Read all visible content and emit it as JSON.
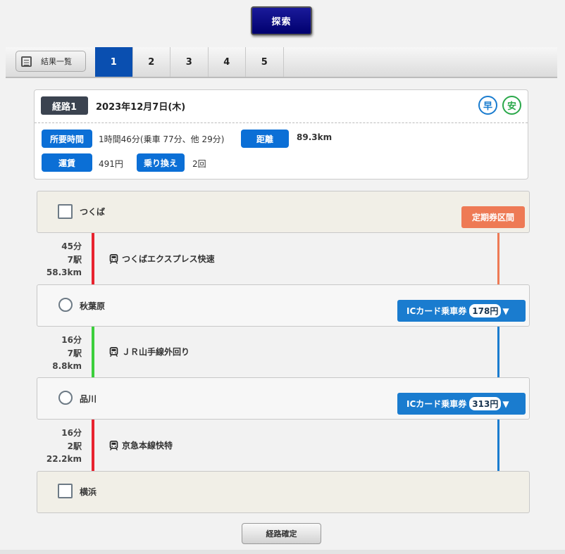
{
  "search_button": "探索",
  "tabbar": {
    "list_label": "結果一覧",
    "tabs": [
      "1",
      "2",
      "3",
      "4",
      "5"
    ],
    "active_tab": "1"
  },
  "summary": {
    "route_label": "経路1",
    "date": "2023年12月7日(木)",
    "badge_fast": "早",
    "badge_safe": "安",
    "time_label": "所要時間",
    "time_value": "1時間46分(乗車 77分、他 29分)",
    "distance_label": "距離",
    "distance_value": "89.3km",
    "fare_label": "運賃",
    "fare_value": "491円",
    "transfer_label": "乗り換え",
    "transfer_value": "2回"
  },
  "stations": [
    {
      "name": "つくば",
      "tag": "定期券区間"
    },
    {
      "name": "秋葉原",
      "fare_type": "ICカード乗車券",
      "fare": "178円",
      "arrow": "▼"
    },
    {
      "name": "品川",
      "fare_type": "ICカード乗車券",
      "fare": "313円",
      "arrow": "▼"
    },
    {
      "name": "横浜"
    }
  ],
  "segments": [
    {
      "time": "45分",
      "stops": "7駅",
      "distance": "58.3km",
      "line": "つくばエクスプレス快速",
      "color": "#e8232f"
    },
    {
      "time": "16分",
      "stops": "7駅",
      "distance": "8.8km",
      "line": "ＪＲ山手線外回り",
      "color": "#3ccf3c"
    },
    {
      "time": "16分",
      "stops": "2駅",
      "distance": "22.2km",
      "line": "京急本線快特",
      "color": "#e8232f"
    }
  ],
  "right_line_colors": {
    "commuter": "#ee7a55",
    "ic": "#1a7ccf"
  },
  "confirm_button": "経路確定"
}
